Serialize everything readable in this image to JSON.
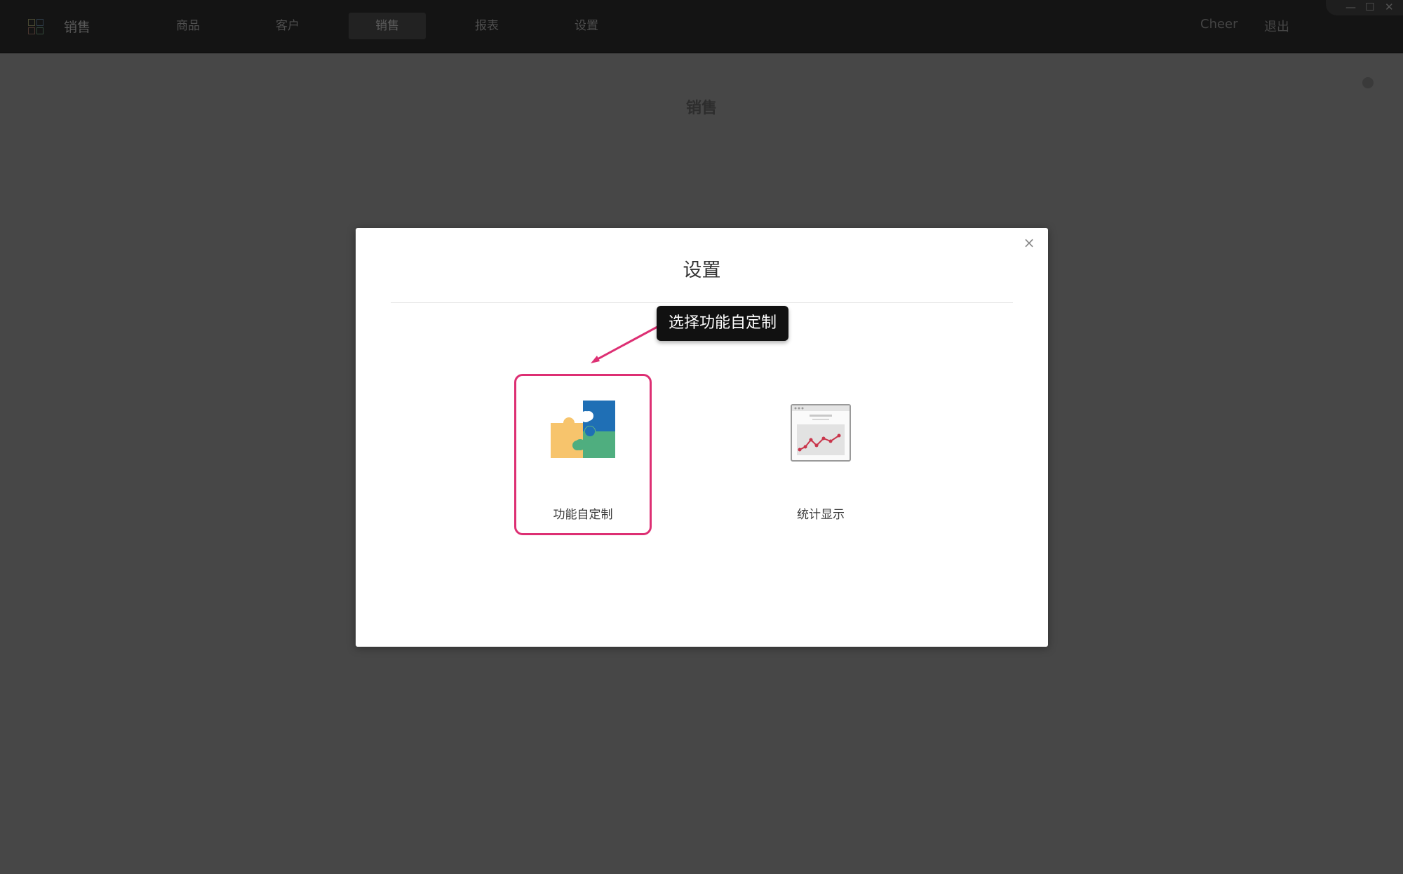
{
  "app": {
    "name": "销售"
  },
  "nav": {
    "items": [
      {
        "label": "商品",
        "active": false
      },
      {
        "label": "客户",
        "active": false
      },
      {
        "label": "销售",
        "active": true
      },
      {
        "label": "报表",
        "active": false
      },
      {
        "label": "设置",
        "active": false
      }
    ],
    "user": "Cheer",
    "logout": "退出"
  },
  "window_controls": {
    "minimize": "—",
    "maximize": "☐",
    "close": "✕"
  },
  "page": {
    "title": "销售"
  },
  "modal": {
    "title": "设置",
    "close": "×",
    "options": [
      {
        "label": "功能自定制",
        "icon": "puzzle-icon",
        "selected": true
      },
      {
        "label": "统计显示",
        "icon": "line-chart-icon",
        "selected": false
      }
    ]
  },
  "annotation": {
    "text": "选择功能自定制",
    "color": "#dd2f73"
  },
  "colors": {
    "overlay_bg": "#474747",
    "topbar_bg": "#141414",
    "highlight": "#dd2f73",
    "puzzle_yellow": "#f7c46c",
    "puzzle_blue": "#1f6fb5",
    "puzzle_green": "#4fae7f"
  }
}
